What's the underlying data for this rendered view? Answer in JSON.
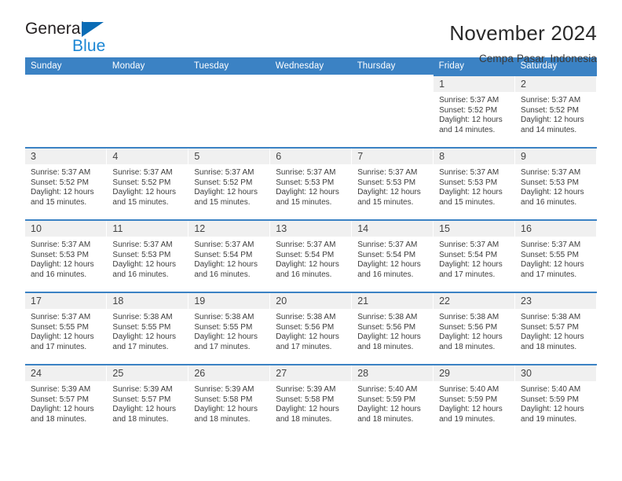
{
  "brand": {
    "name_top": "General",
    "name_bottom": "Blue",
    "triangle_color": "#0b6cb5",
    "blue_text_color": "#1b86d4"
  },
  "header": {
    "title": "November 2024",
    "subtitle": "Cempa Pasar, Indonesia"
  },
  "theme": {
    "header_blue": "#3b82c4",
    "daynum_bg": "#f0f0f0",
    "cell_bg": "#ffffff",
    "text": "#3d3d3d"
  },
  "weekdays": [
    "Sunday",
    "Monday",
    "Tuesday",
    "Wednesday",
    "Thursday",
    "Friday",
    "Saturday"
  ],
  "weeks": [
    [
      {
        "day": "",
        "empty": true
      },
      {
        "day": "",
        "empty": true
      },
      {
        "day": "",
        "empty": true
      },
      {
        "day": "",
        "empty": true
      },
      {
        "day": "",
        "empty": true
      },
      {
        "day": "1",
        "sunrise": "Sunrise: 5:37 AM",
        "sunset": "Sunset: 5:52 PM",
        "daylight1": "Daylight: 12 hours",
        "daylight2": "and 14 minutes."
      },
      {
        "day": "2",
        "sunrise": "Sunrise: 5:37 AM",
        "sunset": "Sunset: 5:52 PM",
        "daylight1": "Daylight: 12 hours",
        "daylight2": "and 14 minutes."
      }
    ],
    [
      {
        "day": "3",
        "sunrise": "Sunrise: 5:37 AM",
        "sunset": "Sunset: 5:52 PM",
        "daylight1": "Daylight: 12 hours",
        "daylight2": "and 15 minutes."
      },
      {
        "day": "4",
        "sunrise": "Sunrise: 5:37 AM",
        "sunset": "Sunset: 5:52 PM",
        "daylight1": "Daylight: 12 hours",
        "daylight2": "and 15 minutes."
      },
      {
        "day": "5",
        "sunrise": "Sunrise: 5:37 AM",
        "sunset": "Sunset: 5:52 PM",
        "daylight1": "Daylight: 12 hours",
        "daylight2": "and 15 minutes."
      },
      {
        "day": "6",
        "sunrise": "Sunrise: 5:37 AM",
        "sunset": "Sunset: 5:53 PM",
        "daylight1": "Daylight: 12 hours",
        "daylight2": "and 15 minutes."
      },
      {
        "day": "7",
        "sunrise": "Sunrise: 5:37 AM",
        "sunset": "Sunset: 5:53 PM",
        "daylight1": "Daylight: 12 hours",
        "daylight2": "and 15 minutes."
      },
      {
        "day": "8",
        "sunrise": "Sunrise: 5:37 AM",
        "sunset": "Sunset: 5:53 PM",
        "daylight1": "Daylight: 12 hours",
        "daylight2": "and 15 minutes."
      },
      {
        "day": "9",
        "sunrise": "Sunrise: 5:37 AM",
        "sunset": "Sunset: 5:53 PM",
        "daylight1": "Daylight: 12 hours",
        "daylight2": "and 16 minutes."
      }
    ],
    [
      {
        "day": "10",
        "sunrise": "Sunrise: 5:37 AM",
        "sunset": "Sunset: 5:53 PM",
        "daylight1": "Daylight: 12 hours",
        "daylight2": "and 16 minutes."
      },
      {
        "day": "11",
        "sunrise": "Sunrise: 5:37 AM",
        "sunset": "Sunset: 5:53 PM",
        "daylight1": "Daylight: 12 hours",
        "daylight2": "and 16 minutes."
      },
      {
        "day": "12",
        "sunrise": "Sunrise: 5:37 AM",
        "sunset": "Sunset: 5:54 PM",
        "daylight1": "Daylight: 12 hours",
        "daylight2": "and 16 minutes."
      },
      {
        "day": "13",
        "sunrise": "Sunrise: 5:37 AM",
        "sunset": "Sunset: 5:54 PM",
        "daylight1": "Daylight: 12 hours",
        "daylight2": "and 16 minutes."
      },
      {
        "day": "14",
        "sunrise": "Sunrise: 5:37 AM",
        "sunset": "Sunset: 5:54 PM",
        "daylight1": "Daylight: 12 hours",
        "daylight2": "and 16 minutes."
      },
      {
        "day": "15",
        "sunrise": "Sunrise: 5:37 AM",
        "sunset": "Sunset: 5:54 PM",
        "daylight1": "Daylight: 12 hours",
        "daylight2": "and 17 minutes."
      },
      {
        "day": "16",
        "sunrise": "Sunrise: 5:37 AM",
        "sunset": "Sunset: 5:55 PM",
        "daylight1": "Daylight: 12 hours",
        "daylight2": "and 17 minutes."
      }
    ],
    [
      {
        "day": "17",
        "sunrise": "Sunrise: 5:37 AM",
        "sunset": "Sunset: 5:55 PM",
        "daylight1": "Daylight: 12 hours",
        "daylight2": "and 17 minutes."
      },
      {
        "day": "18",
        "sunrise": "Sunrise: 5:38 AM",
        "sunset": "Sunset: 5:55 PM",
        "daylight1": "Daylight: 12 hours",
        "daylight2": "and 17 minutes."
      },
      {
        "day": "19",
        "sunrise": "Sunrise: 5:38 AM",
        "sunset": "Sunset: 5:55 PM",
        "daylight1": "Daylight: 12 hours",
        "daylight2": "and 17 minutes."
      },
      {
        "day": "20",
        "sunrise": "Sunrise: 5:38 AM",
        "sunset": "Sunset: 5:56 PM",
        "daylight1": "Daylight: 12 hours",
        "daylight2": "and 17 minutes."
      },
      {
        "day": "21",
        "sunrise": "Sunrise: 5:38 AM",
        "sunset": "Sunset: 5:56 PM",
        "daylight1": "Daylight: 12 hours",
        "daylight2": "and 18 minutes."
      },
      {
        "day": "22",
        "sunrise": "Sunrise: 5:38 AM",
        "sunset": "Sunset: 5:56 PM",
        "daylight1": "Daylight: 12 hours",
        "daylight2": "and 18 minutes."
      },
      {
        "day": "23",
        "sunrise": "Sunrise: 5:38 AM",
        "sunset": "Sunset: 5:57 PM",
        "daylight1": "Daylight: 12 hours",
        "daylight2": "and 18 minutes."
      }
    ],
    [
      {
        "day": "24",
        "sunrise": "Sunrise: 5:39 AM",
        "sunset": "Sunset: 5:57 PM",
        "daylight1": "Daylight: 12 hours",
        "daylight2": "and 18 minutes."
      },
      {
        "day": "25",
        "sunrise": "Sunrise: 5:39 AM",
        "sunset": "Sunset: 5:57 PM",
        "daylight1": "Daylight: 12 hours",
        "daylight2": "and 18 minutes."
      },
      {
        "day": "26",
        "sunrise": "Sunrise: 5:39 AM",
        "sunset": "Sunset: 5:58 PM",
        "daylight1": "Daylight: 12 hours",
        "daylight2": "and 18 minutes."
      },
      {
        "day": "27",
        "sunrise": "Sunrise: 5:39 AM",
        "sunset": "Sunset: 5:58 PM",
        "daylight1": "Daylight: 12 hours",
        "daylight2": "and 18 minutes."
      },
      {
        "day": "28",
        "sunrise": "Sunrise: 5:40 AM",
        "sunset": "Sunset: 5:59 PM",
        "daylight1": "Daylight: 12 hours",
        "daylight2": "and 18 minutes."
      },
      {
        "day": "29",
        "sunrise": "Sunrise: 5:40 AM",
        "sunset": "Sunset: 5:59 PM",
        "daylight1": "Daylight: 12 hours",
        "daylight2": "and 19 minutes."
      },
      {
        "day": "30",
        "sunrise": "Sunrise: 5:40 AM",
        "sunset": "Sunset: 5:59 PM",
        "daylight1": "Daylight: 12 hours",
        "daylight2": "and 19 minutes."
      }
    ]
  ]
}
